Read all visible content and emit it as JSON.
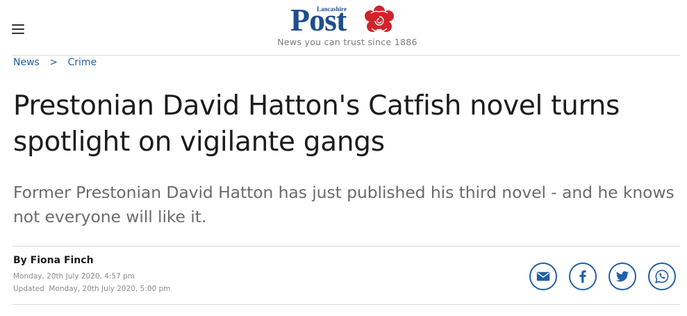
{
  "header": {
    "logo_small": "Lancashire",
    "logo_big": "Post",
    "tagline": "News you can trust since 1886"
  },
  "breadcrumb": {
    "items": [
      "News",
      "Crime"
    ],
    "separator": ">"
  },
  "article": {
    "headline": "Prestonian David Hatton's Catfish novel turns spotlight on vigilante gangs",
    "standfirst": "Former Prestonian David Hatton has just published his third novel - and he knows not everyone will like it.",
    "byline": "By Fiona Finch",
    "published": "Monday, 20th July 2020, 4:57 pm",
    "updated_label": "Updated",
    "updated": "Monday, 20th July 2020, 5:00 pm"
  },
  "share": {
    "icons": [
      "email-icon",
      "facebook-icon",
      "twitter-icon",
      "whatsapp-icon"
    ]
  },
  "colors": {
    "brand": "#1f4e8c",
    "link": "#1f5fa8",
    "rose": "#d3232a"
  }
}
